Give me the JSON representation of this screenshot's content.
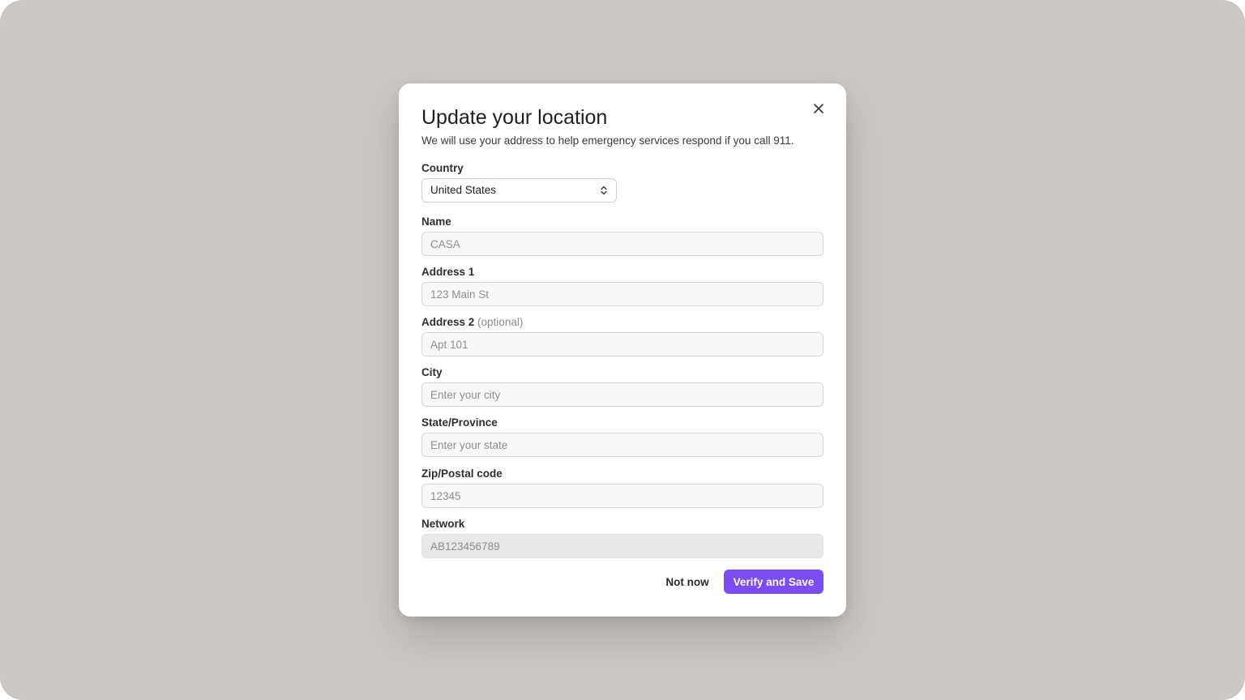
{
  "modal": {
    "title": "Update your location",
    "subtitle": "We will use your address to help emergency services respond if you call 911."
  },
  "country": {
    "label": "Country",
    "value": "United States"
  },
  "name": {
    "label": "Name",
    "placeholder": "CASA"
  },
  "address1": {
    "label": "Address 1",
    "placeholder": "123 Main St"
  },
  "address2": {
    "label": "Address 2",
    "optional": "(optional)",
    "placeholder": "Apt 101"
  },
  "city": {
    "label": "City",
    "placeholder": "Enter your city"
  },
  "state": {
    "label": "State/Province",
    "placeholder": "Enter your state"
  },
  "zip": {
    "label": "Zip/Postal code",
    "placeholder": "12345"
  },
  "network": {
    "label": "Network",
    "placeholder": "AB123456789"
  },
  "actions": {
    "cancel_label": "Not now",
    "submit_label": "Verify and Save"
  },
  "icons": {
    "close": "close-icon",
    "select_caret": "chevron-up-down-icon"
  },
  "colors": {
    "backdrop": "#cdc8c4",
    "primary": "#7b4cf2"
  }
}
